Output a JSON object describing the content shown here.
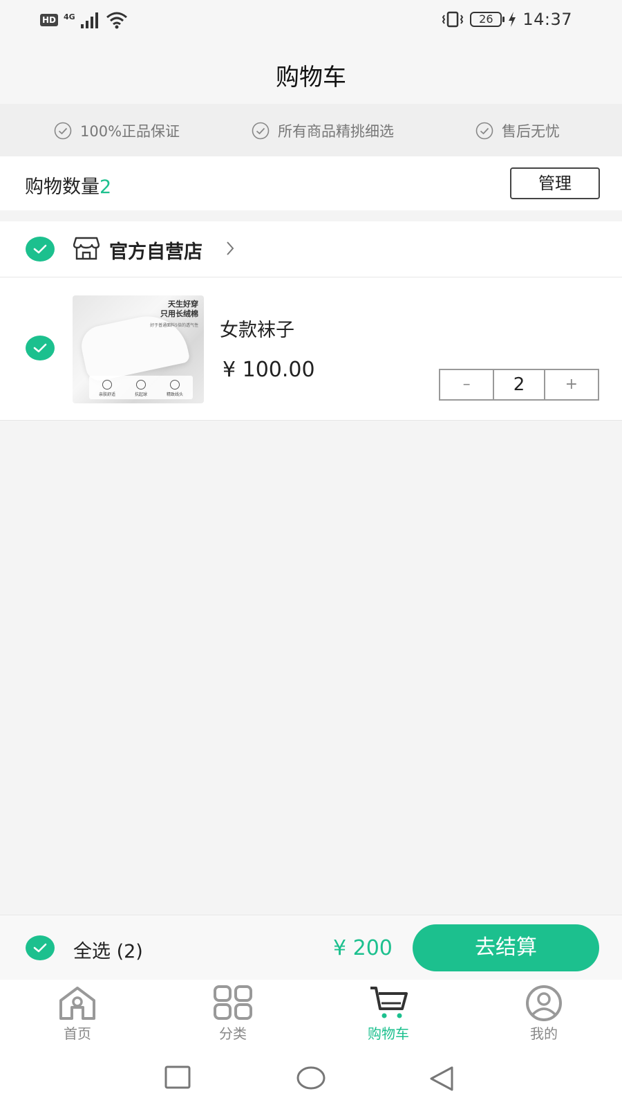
{
  "status_bar": {
    "hd": "HD",
    "network": "4G",
    "battery": "26",
    "time": "14:37"
  },
  "header": {
    "title": "购物车"
  },
  "guarantees": [
    {
      "label": "100%正品保证",
      "icon": "check-circle-icon"
    },
    {
      "label": "所有商品精挑细选",
      "icon": "check-circle-icon"
    },
    {
      "label": "售后无忧",
      "icon": "check-circle-icon"
    }
  ],
  "summary": {
    "label": "购物数量",
    "count": "2",
    "manage_label": "管理"
  },
  "store": {
    "name": "官方自营店",
    "checked": true,
    "icon": "store-icon"
  },
  "product": {
    "name": "女款袜子",
    "price": "¥ 100.00",
    "quantity": "2",
    "minus": "–",
    "plus": "+",
    "checked": true,
    "image_texts": {
      "headline1": "天生好穿",
      "headline2": "只用长绒棉",
      "small": "好于普通面料5倍的透气性",
      "feat1": "亲肤舒适",
      "feat2": "抗起球",
      "feat3": "精致线头"
    }
  },
  "checkout": {
    "select_all": "全选 (2)",
    "total": "¥ 200",
    "pay_label": "去结算",
    "accent": "#1cc08e"
  },
  "tabbar": {
    "items": [
      {
        "label": "首页",
        "icon": "home-icon",
        "active": false
      },
      {
        "label": "分类",
        "icon": "category-icon",
        "active": false
      },
      {
        "label": "购物车",
        "icon": "cart-icon",
        "active": true
      },
      {
        "label": "我的",
        "icon": "profile-icon",
        "active": false
      }
    ]
  },
  "system_nav": {
    "icons": [
      "recent-apps-icon",
      "home-circle-icon",
      "back-icon"
    ]
  }
}
